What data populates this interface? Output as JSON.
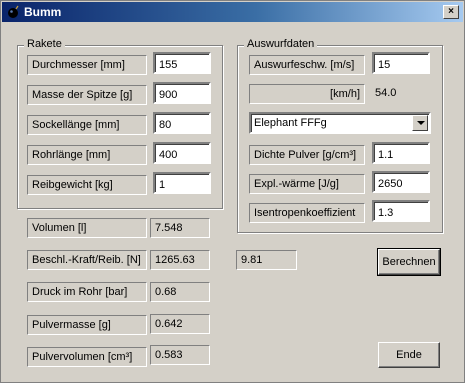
{
  "window": {
    "title": "Bumm",
    "close_label": "×"
  },
  "rakete": {
    "title": "Rakete",
    "fields": [
      {
        "label": "Durchmesser [mm]",
        "value": "155"
      },
      {
        "label": "Masse der Spitze  [g]",
        "value": "900"
      },
      {
        "label": "Sockellänge  [mm]",
        "value": "80"
      },
      {
        "label": "Rohrlänge [mm]",
        "value": "400"
      },
      {
        "label": "Reibgewicht [kg]",
        "value": "1"
      }
    ]
  },
  "auswurf": {
    "title": "Auswurfdaten",
    "speed_label": "Auswurfeschw.  [m/s]",
    "speed_value": "15",
    "kmh_label": "[km/h]",
    "kmh_value": "54.0",
    "powder_selected": "Elephant FFFg",
    "dichte_label": "Dichte Pulver  [g/cm³]",
    "dichte_value": "1.1",
    "expl_label": "Expl.-wärme  [J/g]",
    "expl_value": "2650",
    "isen_label": "Isentropenkoeffizient",
    "isen_value": "1.3"
  },
  "results": [
    {
      "label": "Volumen [l]",
      "value": "7.548"
    },
    {
      "label": "Beschl.-Kraft/Reib. [N]",
      "value": "1265.63"
    },
    {
      "label": "Druck im Rohr [bar]",
      "value": "0.68"
    },
    {
      "label": "Pulvermasse [g]",
      "value": "0.642"
    },
    {
      "label": "Pulvervolumen [cm³]",
      "value": "0.583"
    }
  ],
  "gravity_value": "9.81",
  "buttons": {
    "berechnen": "Berechnen",
    "ende": "Ende"
  }
}
